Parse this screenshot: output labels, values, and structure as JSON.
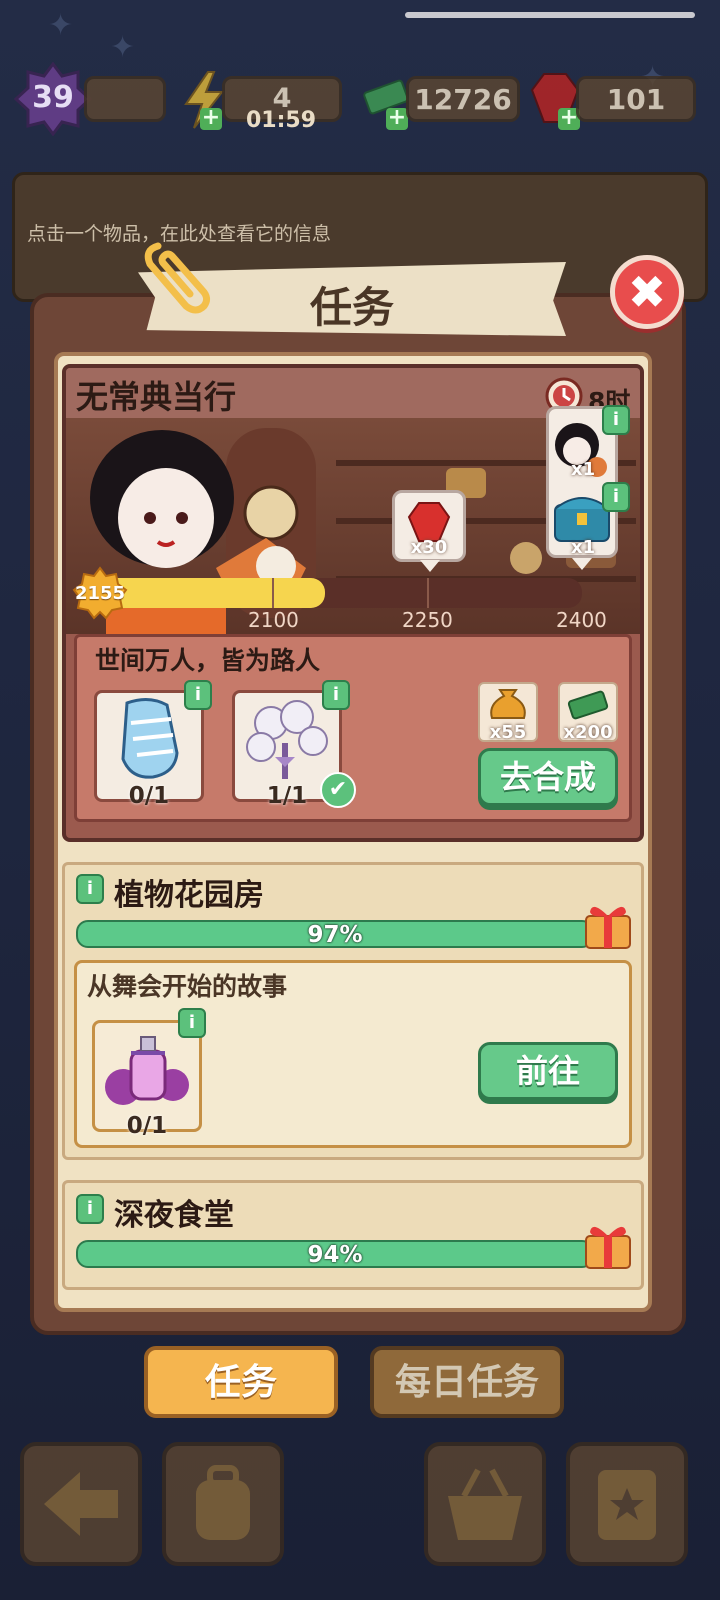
{
  "status": {
    "level": "39",
    "energy": "4",
    "energy_timer": "01:59",
    "cash": "12726",
    "gems": "101"
  },
  "info_hint": "点击一个物品，在此处查看它的信息",
  "panel_title": "任务",
  "event": {
    "title": "无常典当行",
    "time_left": "8时48分",
    "current_points": "2155",
    "progress_fraction": 0.48,
    "ticks": [
      "2100",
      "2250",
      "2400"
    ],
    "milestone_gem_qty": "x30",
    "final_reward_qtys": [
      "x1",
      "x1"
    ],
    "quest": {
      "title": "世间万人，皆为路人",
      "items": [
        {
          "name": "bottle",
          "count": "0/1",
          "done": false
        },
        {
          "name": "flower-bouquet",
          "count": "1/1",
          "done": true
        }
      ],
      "rewards": [
        {
          "icon": "coin-bag-icon",
          "qty": "x55"
        },
        {
          "icon": "cash-stack-icon",
          "qty": "x200"
        }
      ],
      "button": "去合成"
    }
  },
  "sections": [
    {
      "title": "植物花园房",
      "percent_text": "97%",
      "percent": 97,
      "quest_title": "从舞会开始的故事",
      "item_count": "0/1",
      "button": "前往"
    },
    {
      "title": "深夜食堂",
      "percent_text": "94%",
      "percent": 94
    }
  ],
  "tabs": {
    "tasks": "任务",
    "daily": "每日任务"
  },
  "colors": {
    "accent_green": "#66c98a",
    "progress_yellow": "#f6d54e",
    "close_red": "#e84d4d",
    "tab_active": "#f5b54f"
  }
}
